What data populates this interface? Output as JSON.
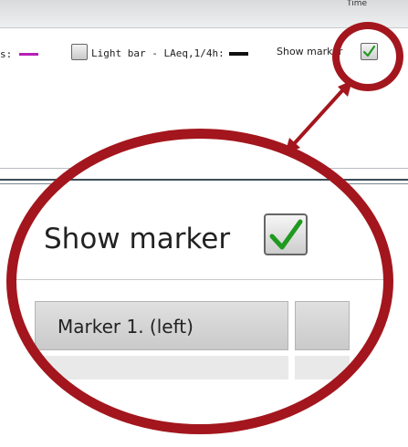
{
  "top": {
    "time_label": "Time"
  },
  "legend": {
    "cut_label": "s:",
    "purple_color": "#b620b6",
    "light_bar_label": "Light bar - LAeq,1/4h:",
    "light_bar_checked": false,
    "black_color": "#111111",
    "show_marker_label": "Show marker",
    "show_marker_checked": true
  },
  "zoom": {
    "show_marker_label": "Show marker",
    "show_marker_checked": true,
    "marker_header_label": "Marker 1. (left)",
    "ring_color": "#a3161d",
    "check_color": "#1f9a1f"
  }
}
